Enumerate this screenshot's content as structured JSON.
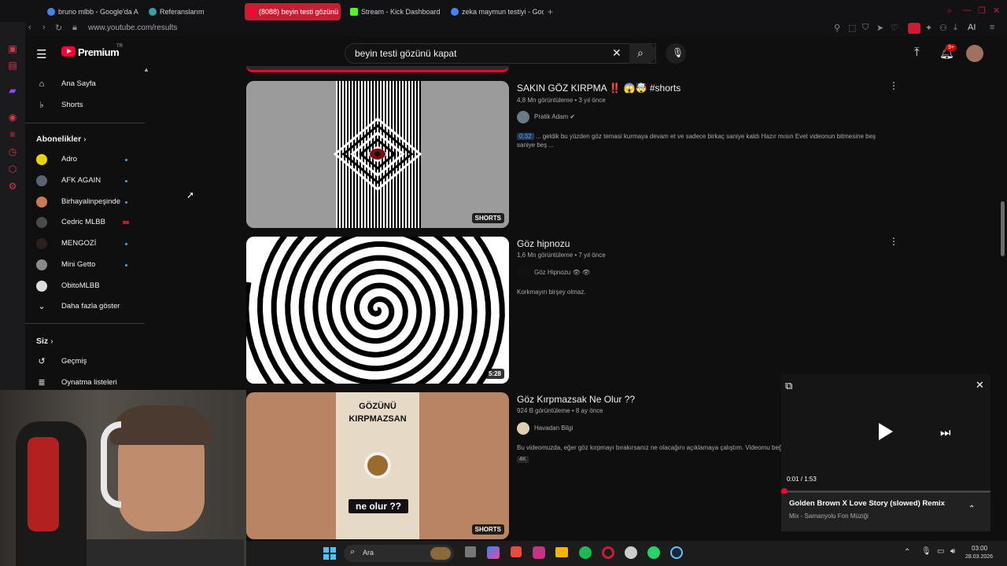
{
  "browser": {
    "tabs": [
      {
        "label": "bruno mlbb - Google'da Ar",
        "color": "#4285f4"
      },
      {
        "label": "Referanslarım",
        "color": "#3aa0a0"
      },
      {
        "label": "(8088) beyin testi gözünü",
        "color": "#ff0033"
      },
      {
        "label": "Stream - Kick Dashboard",
        "color": "#53fc18"
      },
      {
        "label": "zeka maymun testiyi - Goo",
        "color": "#4285f4"
      }
    ],
    "url": "www.youtube.com/results",
    "ai_label": "AI"
  },
  "youtube": {
    "logo_text": "Premium",
    "logo_sup": "TR",
    "search_value": "beyin testi gözünü kapat",
    "notif_count": "9+"
  },
  "sidebar": {
    "home": "Ana Sayfa",
    "shorts": "Shorts",
    "subs_title": "Abonelikler",
    "subs": [
      {
        "label": "Adro",
        "color": "#e8d500"
      },
      {
        "label": "AFK AGAIN",
        "color": "#5a6470"
      },
      {
        "label": "Birhayalinpeşinde",
        "color": "#c77a5a"
      },
      {
        "label": "Cedric MLBB",
        "color": "#4a4a4a"
      },
      {
        "label": "MENGOZİ",
        "color": "#2b2020"
      },
      {
        "label": "Mini Getto",
        "color": "#8a8a8a"
      },
      {
        "label": "ObitoMLBB",
        "color": "#dddddd"
      }
    ],
    "show_more": "Daha fazla göster",
    "you_title": "Siz",
    "history": "Geçmiş",
    "playlists": "Oynatma listeleri"
  },
  "results": [
    {
      "title": "SAKIN GÖZ KIRPMA ‼️ 😱🤯 #shorts",
      "meta": "4,8 Mn görüntüleme • 3 yıl önce",
      "channel": "Pratik Adam ✔",
      "timestamp": "0:32",
      "desc": "... geldik bu yüzden göz temasi kurmaya devam et ve sadece birkaç saniye kaldı Hazır mısın Evet videonun bitmesine beş saniye beş ...",
      "badge": "SHORTS"
    },
    {
      "title": "Göz hipnozu",
      "meta": "1,6 Mn görüntüleme • 7 yıl önce",
      "channel": "Göz Hipnozu 👁 👁",
      "desc": "Korkmayın birşey olmaz.",
      "badge": "5:28"
    },
    {
      "title": "Göz Kırpmazsak Ne Olur ??",
      "meta": "924 B görüntüleme • 8 ay önce",
      "channel": "Havadan Bilgi",
      "desc": "Bu videomuzda, eğer göz kırpmayı bırakırsanız ne olacağını açıklamaya çalıştım. Videomu beğ",
      "tag": "4K",
      "badge": "SHORTS",
      "thumb_text_1": "GÖZÜNÜ",
      "thumb_text_2": "KIRPMAZSAN",
      "thumb_text_3": "ne olur ??"
    }
  ],
  "miniplayer": {
    "time": "0:01 / 1:53",
    "progress": 0.01,
    "title": "Golden Brown X Love Story (slowed) Remix",
    "subtitle": "Mix - Samanyolu Fon Müziği"
  },
  "taskbar": {
    "search_label": "Ara",
    "time": "03:00",
    "date": "28.03.2026"
  }
}
